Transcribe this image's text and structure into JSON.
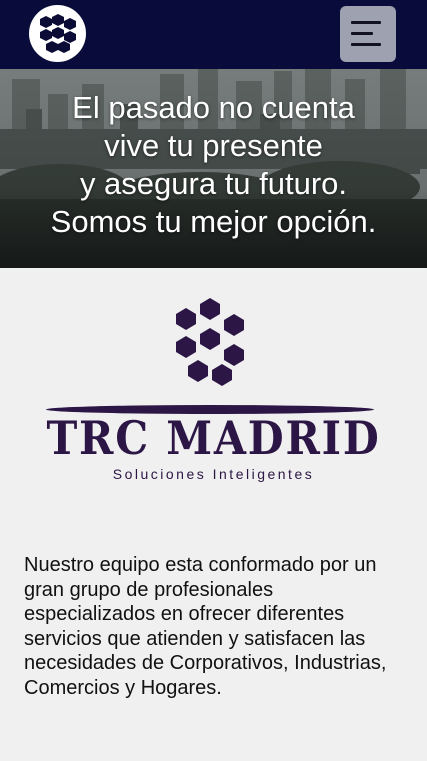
{
  "header": {
    "logo_icon": "hexagon-cluster-logo",
    "menu_icon": "hamburger-menu-icon"
  },
  "hero": {
    "lines": [
      "El pasado no cuenta",
      "vive tu presente",
      "y asegura tu futuro.",
      "Somos tu mejor opción."
    ]
  },
  "logo": {
    "title": "TRC MADRID",
    "subtitle": "Soluciones Inteligentes",
    "color": "#2c1645"
  },
  "intro": {
    "text": "Nuestro equipo esta conformado por un gran grupo de profesionales especializados en ofrecer diferentes servicios que atienden y satisfacen las necesidades de Corporativos, Industrias, Comercios y Hogares."
  },
  "colors": {
    "topbar": "#090c3a",
    "menu_button": "#9da1b0",
    "page_bg": "#f1f0f1"
  }
}
